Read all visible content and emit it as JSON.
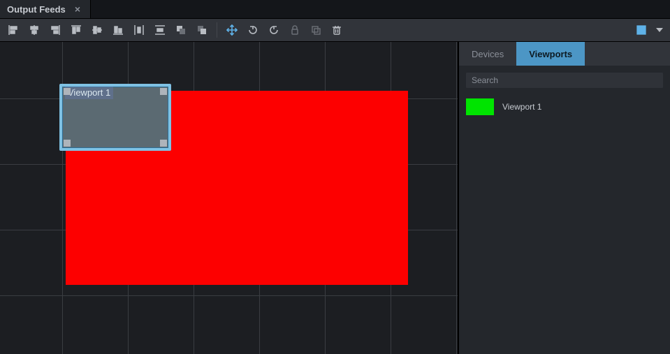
{
  "tab": {
    "title": "Output Feeds"
  },
  "toolbar": {
    "align_left": "align-left",
    "align_center_h": "align-center-h",
    "align_right": "align-right",
    "align_top": "align-top",
    "align_center_v": "align-center-v",
    "align_bottom": "align-bottom",
    "distribute_h": "distribute-h",
    "distribute_v": "distribute-v",
    "send_back": "send-back",
    "bring_front": "bring-front",
    "move": "move",
    "rotate_ccw": "rotate-ccw",
    "rotate_cw": "rotate-cw",
    "lock": "lock",
    "duplicate": "duplicate",
    "delete": "delete",
    "grid_toggle": "grid-toggle",
    "grid_menu": "grid-menu"
  },
  "canvas": {
    "feed_color": "#fd0000",
    "viewport": {
      "label": "Viewport 1",
      "border": "#7fc1e3",
      "bg": "#5b6a72"
    }
  },
  "right": {
    "tabs": {
      "devices": "Devices",
      "viewports": "Viewports",
      "active": "viewports"
    },
    "search_placeholder": "Search",
    "items": [
      {
        "name": "Viewport 1",
        "color": "#00e400"
      }
    ]
  }
}
